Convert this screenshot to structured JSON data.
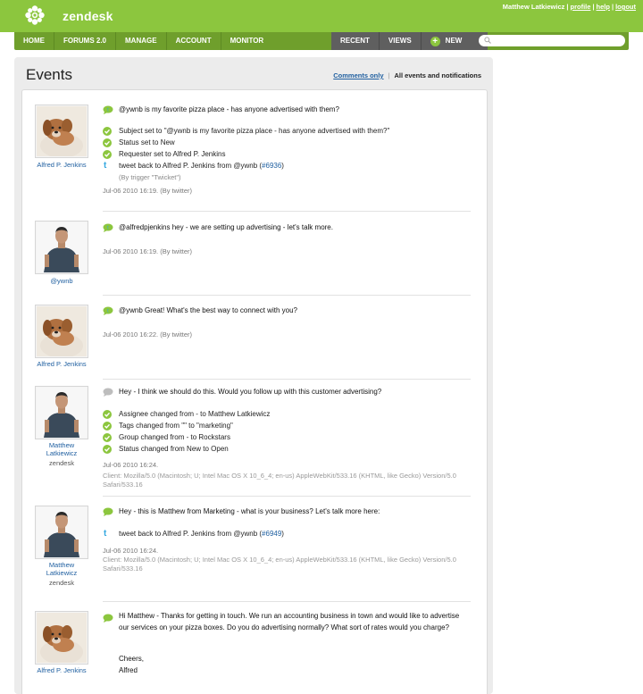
{
  "header": {
    "brand": "zendesk",
    "user_name": "Matthew Latkiewicz",
    "links": [
      "profile",
      "help",
      "logout"
    ],
    "accent_color": "#8cc63e"
  },
  "nav": {
    "left": [
      "HOME",
      "FORUMS 2.0",
      "MANAGE",
      "ACCOUNT",
      "MONITOR"
    ],
    "right": [
      "RECENT",
      "VIEWS",
      "NEW"
    ],
    "search": {
      "placeholder": "",
      "icon": "search-icon"
    }
  },
  "page": {
    "title": "Events",
    "filter_link": "Comments only",
    "filter_active": "All events and notifications"
  },
  "events": [
    {
      "author": "Alfred P. Jenkins",
      "avatar": "dog-avatar",
      "comment": "@ywnb is my favorite pizza place - has anyone advertised with them?",
      "changes": [
        {
          "icon": "check-icon",
          "text": "Subject set to \"@ywnb is my favorite pizza place - has anyone advertised with them?\""
        },
        {
          "icon": "check-icon",
          "text": "Status set to New"
        },
        {
          "icon": "check-icon",
          "text": "Requester set to Alfred P. Jenkins"
        },
        {
          "icon": "twitter-icon",
          "text": "tweet back to Alfred P. Jenkins from @ywnb (",
          "link": "#6936",
          "after": ")"
        }
      ],
      "trigger": "(By trigger \"Twicket\")",
      "meta": "Jul-06 2010 16:19. (By twitter)"
    },
    {
      "author": "@ywnb",
      "avatar": "man-avatar",
      "comment": "@alfredpjenkins hey - we are setting up advertising - let's talk more.",
      "meta": "Jul-06 2010 16:19. (By twitter)"
    },
    {
      "author": "Alfred P. Jenkins",
      "avatar": "dog-avatar",
      "comment": "@ywnb Great! What's the best way to connect with you?",
      "meta": "Jul-06 2010 16:22. (By twitter)"
    },
    {
      "author": "Matthew Latkiewicz",
      "org": "zendesk",
      "avatar": "man-avatar",
      "comment": "Hey - I think we should do this. Would you follow up with this customer advertising?",
      "changes": [
        {
          "icon": "check-icon",
          "text": "Assignee changed from - to Matthew Latkiewicz"
        },
        {
          "icon": "check-icon",
          "text": "Tags changed from \"\" to \"marketing\""
        },
        {
          "icon": "check-icon",
          "text": "Group changed from - to Rockstars"
        },
        {
          "icon": "check-icon",
          "text": "Status changed from New to Open"
        }
      ],
      "meta": "Jul-06 2010 16:24.",
      "client": "Client: Mozilla/5.0 (Macintosh; U; Intel Mac OS X 10_6_4; en-us) AppleWebKit/533.16 (KHTML, like Gecko) Version/5.0 Safari/533.16"
    },
    {
      "author": "Matthew Latkiewicz",
      "org": "zendesk",
      "avatar": "man-avatar",
      "comment": "Hey - this is Matthew from Marketing - what is your business? Let's talk more here:",
      "changes": [
        {
          "icon": "twitter-icon",
          "text": "tweet back to Alfred P. Jenkins from @ywnb (",
          "link": "#6949",
          "after": ")"
        }
      ],
      "meta": "Jul-06 2010 16:24.",
      "client": "Client: Mozilla/5.0 (Macintosh; U; Intel Mac OS X 10_6_4; en-us) AppleWebKit/533.16 (KHTML, like Gecko) Version/5.0 Safari/533.16"
    },
    {
      "author": "Alfred P. Jenkins",
      "avatar": "dog-avatar",
      "comment": "Hi Matthew - Thanks for getting in touch. We run an accounting business in town and would like to advertise our services on your pizza boxes. Do you do advertising normally? What sort of rates would you charge?",
      "comment2": "Cheers,",
      "comment3": "Alfred"
    }
  ]
}
